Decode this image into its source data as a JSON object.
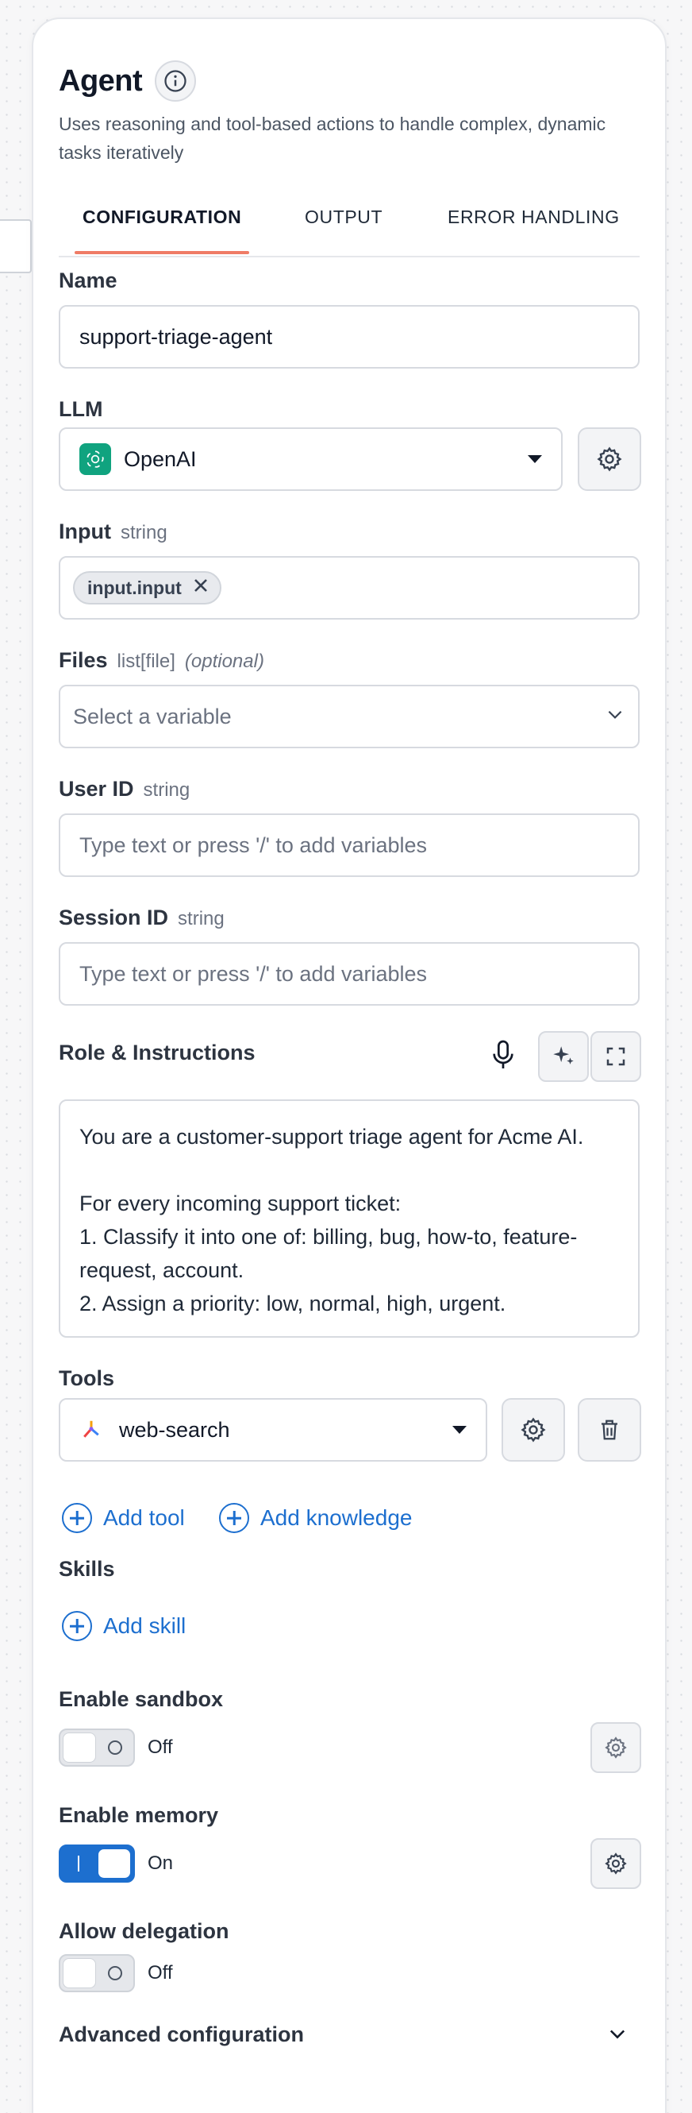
{
  "panel": {
    "title": "Agent",
    "subtitle": "Uses reasoning and tool-based actions to handle complex, dynamic tasks iteratively"
  },
  "tabs": [
    {
      "label": "CONFIGURATION",
      "active": true
    },
    {
      "label": "OUTPUT",
      "active": false
    },
    {
      "label": "ERROR HANDLING",
      "active": false
    }
  ],
  "name": {
    "label": "Name",
    "value": "support-triage-agent"
  },
  "llm": {
    "label": "LLM",
    "provider": "OpenAI"
  },
  "input": {
    "label": "Input",
    "type": "string",
    "chip": "input.input"
  },
  "files": {
    "label": "Files",
    "type": "list[file]",
    "optional": "(optional)",
    "placeholder": "Select a variable"
  },
  "user_id": {
    "label": "User ID",
    "type": "string",
    "placeholder": "Type text or press '/' to add variables"
  },
  "session_id": {
    "label": "Session ID",
    "type": "string",
    "placeholder": "Type text or press '/' to add variables"
  },
  "instructions": {
    "label": "Role & Instructions",
    "text": "You are a customer-support triage agent for Acme AI.\n\nFor every incoming support ticket:\n1. Classify it into one of: billing, bug, how-to, feature-request, account.\n2. Assign a priority: low, normal, high, urgent."
  },
  "tools": {
    "label": "Tools",
    "selected": "web-search",
    "add_tool": "Add tool",
    "add_knowledge": "Add knowledge"
  },
  "skills": {
    "label": "Skills",
    "add_skill": "Add skill"
  },
  "sandbox": {
    "label": "Enable sandbox",
    "state": "Off",
    "on": false
  },
  "memory": {
    "label": "Enable memory",
    "state": "On",
    "on": true
  },
  "delegation": {
    "label": "Allow delegation",
    "state": "Off",
    "on": false
  },
  "advanced": {
    "label": "Advanced configuration"
  },
  "colors": {
    "accent": "#1d6fcf",
    "tab_underline": "#ef7c66",
    "openai": "#10a37f"
  }
}
